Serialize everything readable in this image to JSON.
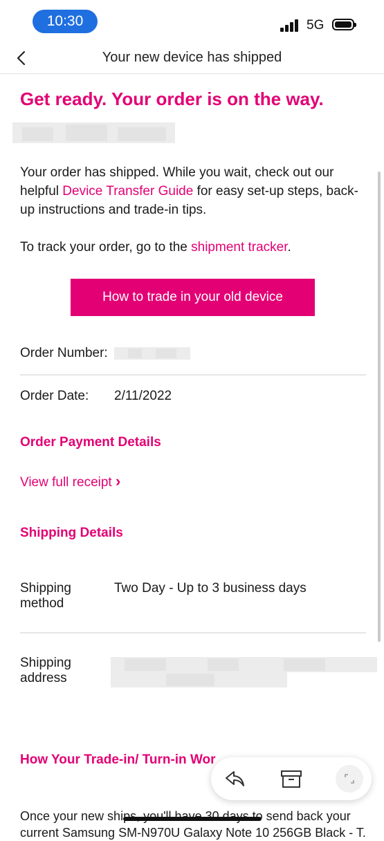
{
  "status_bar": {
    "time": "10:30",
    "network": "5G"
  },
  "nav": {
    "title": "Your new device has shipped"
  },
  "headline": "Get ready. Your order is on the way.",
  "intro": {
    "part1": "Your order has shipped. While you wait, check out our helpful ",
    "link": "Device Transfer Guide",
    "part2": " for easy set-up steps, back-up instructions and trade-in tips."
  },
  "track": {
    "part1": "To track your order, go to the ",
    "link": "shipment tracker",
    "part2": "."
  },
  "cta_label": "How to trade in your old device",
  "order": {
    "number_label": "Order Number:",
    "date_label": "Order Date:",
    "date_value": "2/11/2022"
  },
  "payment": {
    "heading": "Order Payment Details",
    "receipt_link": "View full receipt",
    "receipt_chevron": "›"
  },
  "shipping": {
    "heading": "Shipping Details",
    "method_label_line1": "Shipping",
    "method_label_line2": "method",
    "method_value": "Two Day - Up to 3 business days",
    "address_label_line1": "Shipping",
    "address_label_line2": "address"
  },
  "tradein": {
    "heading": "How Your Trade-in/ Turn-in Wor",
    "body_line1": "Once your new ships, you'll have 30 days to send back your",
    "body_line2": "current Samsung SM-N970U Galaxy Note 10 256GB Black - T..."
  },
  "colors": {
    "brand": "#e20074",
    "status_pill": "#1f6fe0"
  },
  "icons": {
    "back": "chevron-left-icon",
    "reply": "reply-icon",
    "archive": "archive-icon",
    "expand": "expand-icon"
  }
}
